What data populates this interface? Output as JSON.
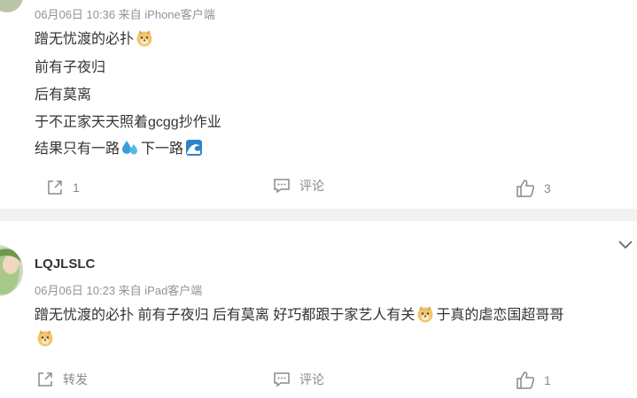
{
  "comment1": {
    "meta": "06月06日 10:36  来自 iPhone客户端",
    "lines": [
      "蹭无忧渡的必扑",
      "前有子夜归",
      "后有莫离",
      "于不正家天天照着gcgg抄作业",
      "结果只有一路",
      "下一路"
    ],
    "emoji": [
      "doge-emoji",
      "sweat-drops-emoji",
      "wave-emoji"
    ],
    "actions": {
      "share_count": "1",
      "comment_label": "评论",
      "like_count": "3"
    }
  },
  "comment2": {
    "username": "LQJLSLC",
    "meta": "06月06日 10:23  来自 iPad客户端",
    "text_part1": "蹭无忧渡的必扑 前有子夜归 后有莫离 好巧都跟于家艺人有关",
    "text_part2": "于真的虐恋国超哥哥",
    "emoji": [
      "doge-emoji"
    ],
    "actions": {
      "share_label": "转发",
      "comment_label": "评论",
      "like_count": "1"
    }
  },
  "colors": {
    "meta_text": "#939393",
    "body_text": "#333333",
    "divider": "#f2f2f2",
    "icon": "#8a8a8a"
  }
}
